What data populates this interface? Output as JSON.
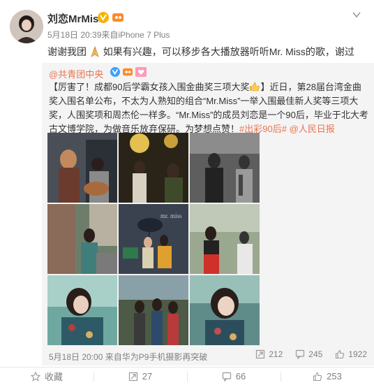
{
  "post": {
    "username": "刘恋MrMiss",
    "meta": "5月18日 20:39来自iPhone 7 Plus",
    "text_before": "谢谢我团",
    "text_after": "如果有兴趣，可以移步各大播放器听听Mr. Miss的歌，谢过"
  },
  "quoted": {
    "author": "@共青团中央",
    "body_main": "【厉害了！成都90后学霸女孩入围金曲奖三项大奖",
    "body_rest": "】近日，第28届台湾金曲奖入围名单公布，不太为人熟知的组合“Mr.Miss”一举入围最佳新人奖等三项大奖，人围奖项和周杰伦一样多。“Mr.Miss”的成员刘恋是一个90后，毕业于北大考古文博学院，为做音乐放弃保研。为梦想点赞！",
    "hashtag": "#出彩90后#",
    "mention": "@人民日报",
    "footer": "5月18日 20:00 来自华为P9手机摄影再突破",
    "reposts": "212",
    "comments": "245",
    "likes": "1922",
    "photo_overlay_text": "mr. miss"
  },
  "bottom_bar": {
    "favorite": "收藏",
    "repost": "27",
    "comment": "66",
    "like": "253"
  },
  "colors": {
    "link": "#eb7350",
    "meta": "#808080",
    "quote_bg": "#f4f4f4",
    "verified": "#f5b400"
  },
  "icons": [
    "chevron-down-icon",
    "pray-icon",
    "thumbs-up-icon",
    "star-icon",
    "repost-icon",
    "comment-icon",
    "like-icon"
  ]
}
